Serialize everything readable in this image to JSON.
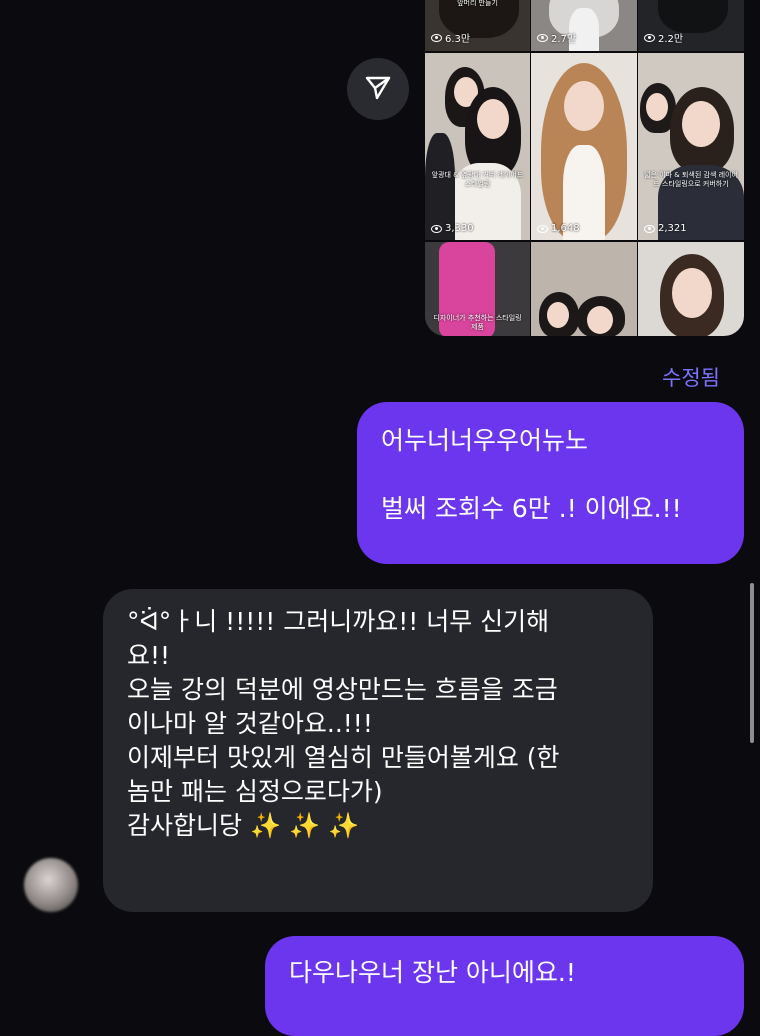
{
  "thread": {
    "media_grid": {
      "tiles": [
        {
          "caption": "앞머리 만들기",
          "views": "6.3만"
        },
        {
          "caption": "",
          "views": "2.7만"
        },
        {
          "caption": "",
          "views": "2.2만"
        },
        {
          "caption": "앞광대 & 옆광대 커버 레이어드 스타일링",
          "views": "3,330"
        },
        {
          "caption": "",
          "views": "1,648"
        },
        {
          "caption": "넓은 이마 & 퇴색된 감색 레이어드 스타일링으로 커버하기",
          "views": "2,321"
        },
        {
          "caption": "디자이너가 추천하는 스타일링 제품",
          "views": ""
        },
        {
          "caption": "",
          "views": ""
        },
        {
          "caption": "",
          "views": ""
        }
      ]
    },
    "edited_label": "수정됨",
    "messages": [
      {
        "side": "sent",
        "text": "어누너너우우어뉴노\n\n벌써 조회수 6만 .! 이에요.!!"
      },
      {
        "side": "received",
        "text": "°ᐛ°ㅏ니 !!!!! 그러니까요!! 너무 신기해\n요!!\n오늘 강의 덕분에 영상만드는 흐름을 조금\n이나마 알 것같아요..!!!\n이제부터 맛있게 열심히 만들어볼게요 (한\n놈만 패는 심정으로다가)\n감사합니당 ✨ ✨ ✨"
      },
      {
        "side": "sent",
        "text": "다우나우너 장난 아니에요.!"
      }
    ]
  },
  "icons": {
    "share": "share-send-icon",
    "views": "eye-icon"
  },
  "colors": {
    "background": "#0b0b0f",
    "sent_bubble": "#6b36ee",
    "received_bubble": "#26272c",
    "edited_label": "#7b74ff"
  }
}
